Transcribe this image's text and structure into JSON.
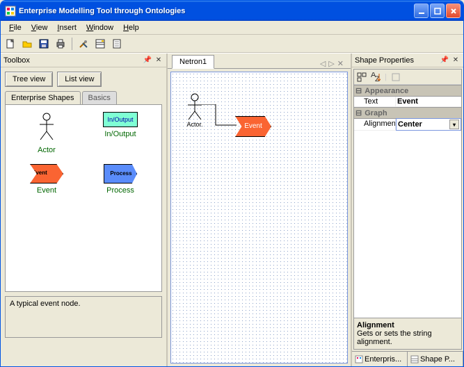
{
  "window": {
    "title": "Enterprise Modelling Tool through Ontologies"
  },
  "menu": {
    "file": "File",
    "view": "View",
    "insert": "Insert",
    "window": "Window",
    "help": "Help"
  },
  "toolbox": {
    "title": "Toolbox",
    "tree_btn": "Tree view",
    "list_btn": "List view",
    "tab_shapes": "Enterprise Shapes",
    "tab_basics": "Basics",
    "items": {
      "actor": "Actor",
      "io": "In/Output",
      "io_shape_label": "In/Output",
      "event": "Event",
      "event_shape_label": "Event",
      "process": "Process",
      "process_shape_label": "Process"
    },
    "hint": "A typical event node."
  },
  "canvas": {
    "tab": "Netron1",
    "actor_label": "Actor.",
    "event_label": "Event"
  },
  "props": {
    "title": "Shape Properties",
    "cat_appearance": "Appearance",
    "row_text_k": "Text",
    "row_text_v": "Event",
    "cat_graph": "Graph",
    "row_align_k": "Alignment",
    "row_align_v": "Center",
    "desc_title": "Alignment",
    "desc_body": "Gets or sets the string alignment.",
    "bottom_tab1": "Enterpris...",
    "bottom_tab2": "Shape P..."
  }
}
